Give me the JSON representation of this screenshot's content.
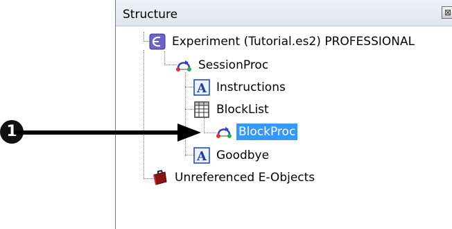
{
  "panel": {
    "title": "Structure",
    "close_glyph": "⊠"
  },
  "tree": [
    {
      "id": "experiment",
      "label": "Experiment (Tutorial.es2) PROFESSIONAL",
      "icon": "experiment-icon"
    },
    {
      "id": "sessionproc",
      "label": "SessionProc",
      "icon": "procedure-icon"
    },
    {
      "id": "instructions",
      "label": "Instructions",
      "icon": "textdisplay-icon"
    },
    {
      "id": "blocklist",
      "label": "BlockList",
      "icon": "list-icon"
    },
    {
      "id": "blockproc",
      "label": "BlockProc",
      "icon": "procedure-icon",
      "selected": true
    },
    {
      "id": "goodbye",
      "label": "Goodbye",
      "icon": "textdisplay-icon"
    },
    {
      "id": "unreferenced",
      "label": "Unreferenced E-Objects",
      "icon": "briefcase-icon"
    }
  ],
  "callout": {
    "number": "1"
  },
  "colors": {
    "selection": "#3399ff",
    "arrow": "#000000"
  }
}
